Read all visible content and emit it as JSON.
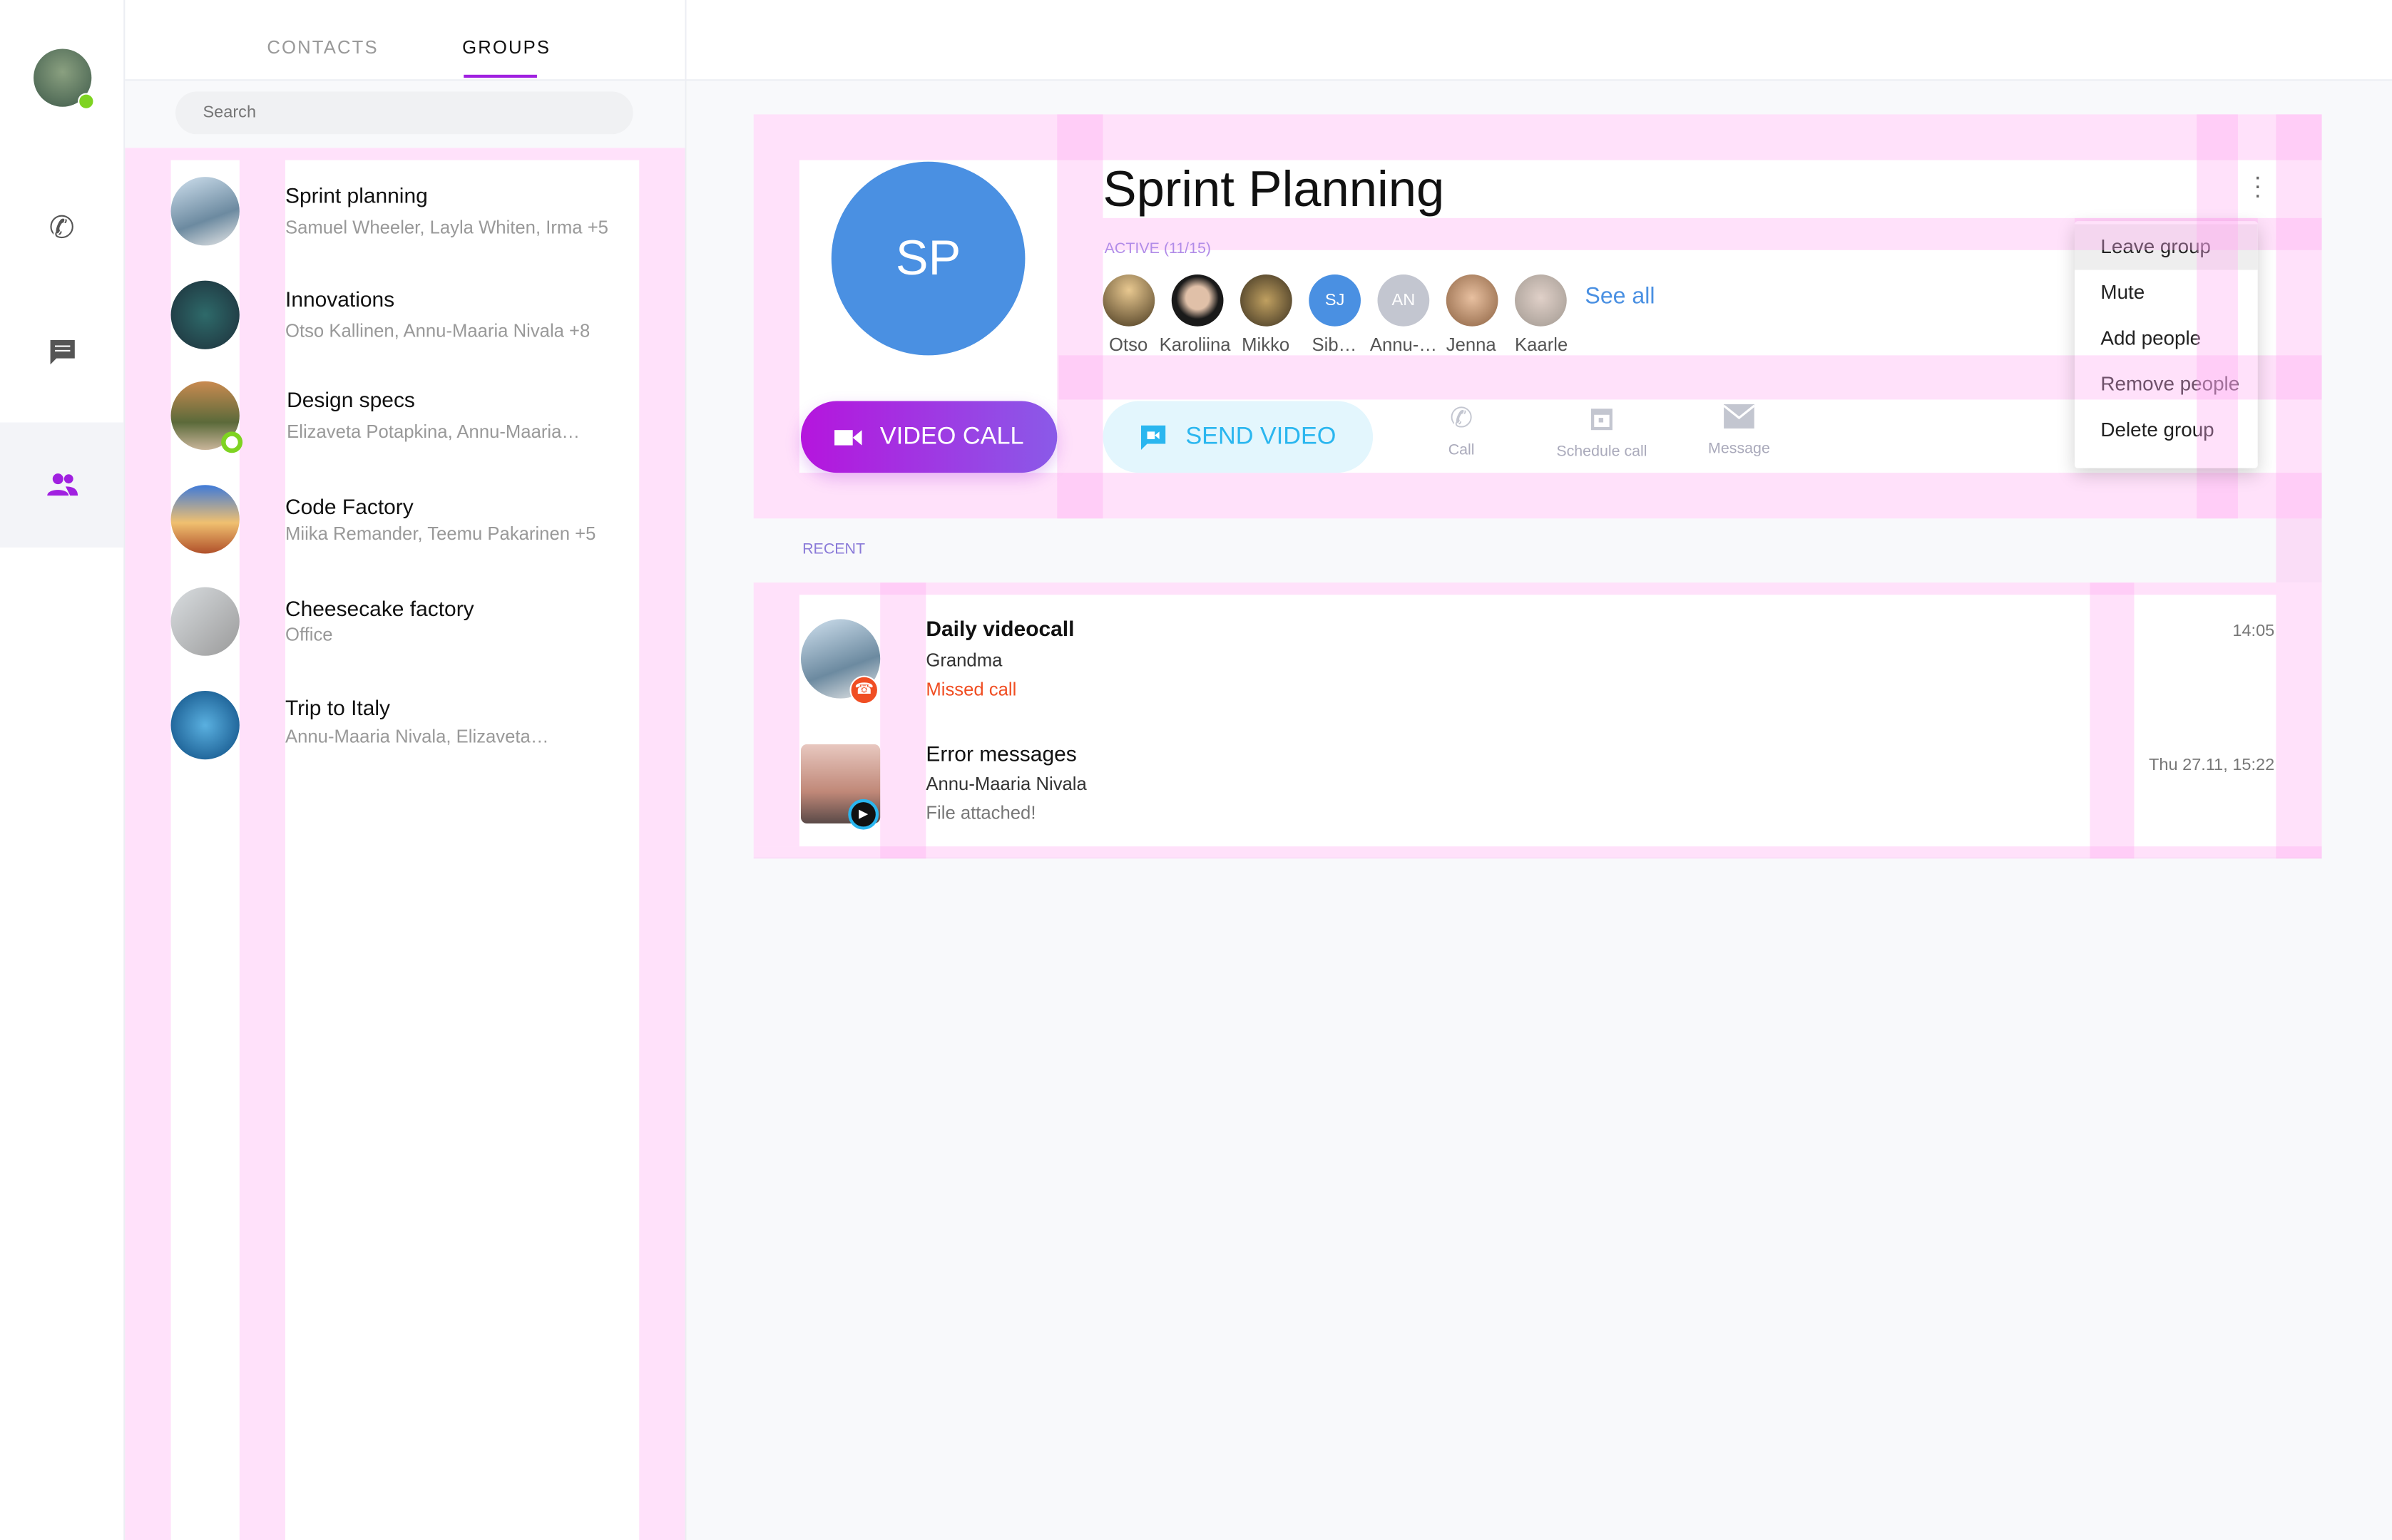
{
  "tabs": {
    "contacts": "CONTACTS",
    "groups": "GROUPS"
  },
  "search": {
    "placeholder": "Search"
  },
  "groups": [
    {
      "name": "Sprint planning",
      "members": "Samuel Wheeler, Layla Whiten, Irma +5"
    },
    {
      "name": "Innovations",
      "members": "Otso Kallinen, Annu-Maaria Nivala +8"
    },
    {
      "name": "Design specs",
      "members": "Elizaveta Potapkina, Annu-Maaria…"
    },
    {
      "name": "Code Factory",
      "members": "Miika Remander, Teemu Pakarinen +5"
    },
    {
      "name": "Cheesecake factory",
      "members": "Office"
    },
    {
      "name": "Trip to Italy",
      "members": "Annu-Maaria Nivala, Elizaveta…"
    }
  ],
  "detail": {
    "initials": "SP",
    "title": "Sprint Planning",
    "active": "ACTIVE (11/15)",
    "members": [
      {
        "name": "Otso"
      },
      {
        "name": "Karoliina"
      },
      {
        "name": "Mikko"
      },
      {
        "name": "Sib…",
        "initials": "SJ"
      },
      {
        "name": "Annu-…",
        "initials": "AN"
      },
      {
        "name": "Jenna"
      },
      {
        "name": "Kaarle"
      }
    ],
    "see_all": "See all",
    "video_call": "VIDEO CALL",
    "send_video": "SEND VIDEO",
    "call": "Call",
    "schedule": "Schedule call",
    "message": "Message"
  },
  "menu": [
    "Leave group",
    "Mute",
    "Add people",
    "Remove people",
    "Delete group"
  ],
  "recent": {
    "label": "RECENT",
    "items": [
      {
        "title": "Daily videocall",
        "person": "Grandma",
        "status": "Missed call",
        "time": "14:05"
      },
      {
        "title": "Error messages",
        "person": "Annu-Maaria Nivala",
        "status": "File attached!",
        "time": "Thu 27.11, 15:22"
      }
    ]
  },
  "colors": {
    "accent": "#a020e0",
    "blue": "#4a90e2",
    "missed": "#f04e23",
    "online": "#7ed321"
  }
}
